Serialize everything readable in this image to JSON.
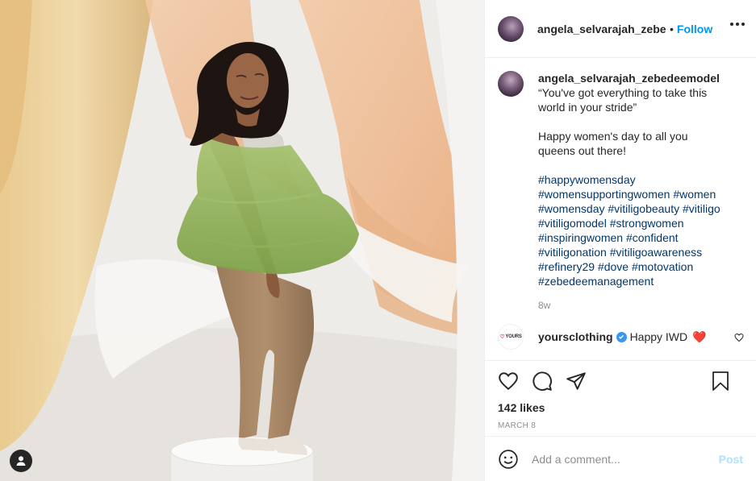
{
  "header": {
    "username": "angela_selvarajah_zebedeemodel",
    "dot": "•",
    "follow_label": "Follow",
    "more_icon": "more-horizontal-icon"
  },
  "caption": {
    "username": "angela_selvarajah_zebedeemodel",
    "quote": "“You've got everything to take this\nworld in your stride”",
    "line2": "Happy women's day to all you\nqueens out there!",
    "hashtags": [
      "#happywomensday",
      "#womensupportingwomen #women",
      "#womensday #vitiligobeauty #vitiligo",
      "#vitiligomodel #strongwomen",
      "#inspiringwomen #confident",
      "#vitiligonation #vitiligoawareness",
      "#refinery29 #dove #motovation",
      "#zebedeemanagement"
    ],
    "age": "8w"
  },
  "comment": {
    "avatar_text": "YOURS",
    "username": "yoursclothing",
    "text": "Happy IWD",
    "emoji": "❤️"
  },
  "actions": {
    "likes": "142 likes",
    "date": "MARCH 8"
  },
  "add_comment": {
    "placeholder": "Add a comment...",
    "post_label": "Post"
  },
  "colors": {
    "link_blue": "#0095f6",
    "hashtag": "#00376b",
    "muted": "#8e8e8e",
    "post_disabled": "#b2dffc",
    "verified": "#3897f0"
  }
}
